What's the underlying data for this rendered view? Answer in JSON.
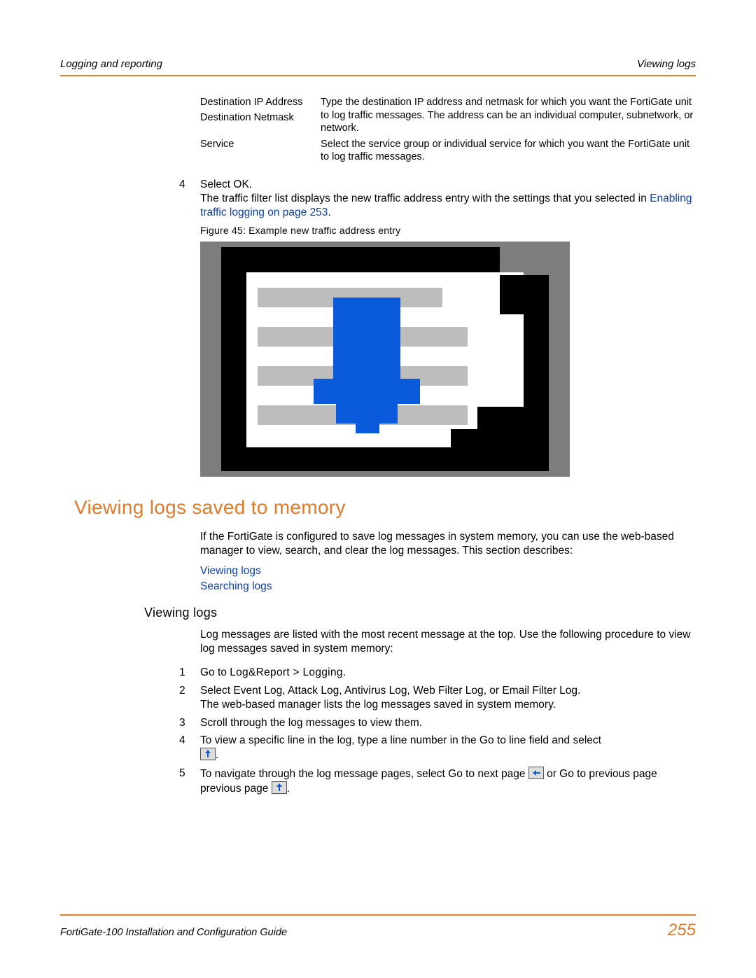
{
  "header": {
    "left": "Logging and reporting",
    "right": "Viewing logs"
  },
  "def": {
    "r1": {
      "term": "Destination IP Address",
      "term2": "Destination Netmask",
      "desc": "Type the destination IP address and netmask for which you want the FortiGate unit to log traffic messages. The address can be an individual computer, subnetwork, or network."
    },
    "r2": {
      "term": "Service",
      "desc": "Select the service group or individual service for which you want the FortiGate unit to log traffic messages."
    }
  },
  "step4": {
    "num": "4",
    "line1": "Select OK.",
    "line2a": "The traffic filter list displays the new traffic address entry with the settings that you selected in ",
    "link": "Enabling traffic logging",
    "linkpage": " on page 253",
    "dot": "."
  },
  "figcap": "Figure 45: Example new traffic address entry",
  "h1": "Viewing logs saved to memory",
  "intro": "If the FortiGate is configured to save log messages in system memory, you can use the web-based manager to view, search, and clear the log messages. This section describes:",
  "sublinks": {
    "a": "Viewing logs",
    "b": "Searching logs"
  },
  "h2": "Viewing logs",
  "intro2": "Log messages are listed with the most recent message at the top. Use the following procedure to view log messages saved in system memory:",
  "steps": {
    "s1": {
      "n": "1",
      "a": "Go to ",
      "b": "Log&Report > Logging",
      "c": "."
    },
    "s2": {
      "n": "2",
      "a": "Select Event Log, Attack Log, Antivirus Log, Web Filter Log, or Email Filter Log.",
      "b": "The web-based manager lists the log messages saved in system memory."
    },
    "s3": {
      "n": "3",
      "a": "Scroll through the log messages to view them."
    },
    "s4": {
      "n": "4",
      "a": "To view a specific line in the log, type a line number in the Go to line field and select"
    },
    "s5": {
      "n": "5",
      "a": "To navigate through the log message pages, select Go to next page ",
      "b": " or Go to previous page "
    }
  },
  "footer": {
    "title": "FortiGate-100 Installation and Configuration Guide",
    "page": "255"
  }
}
